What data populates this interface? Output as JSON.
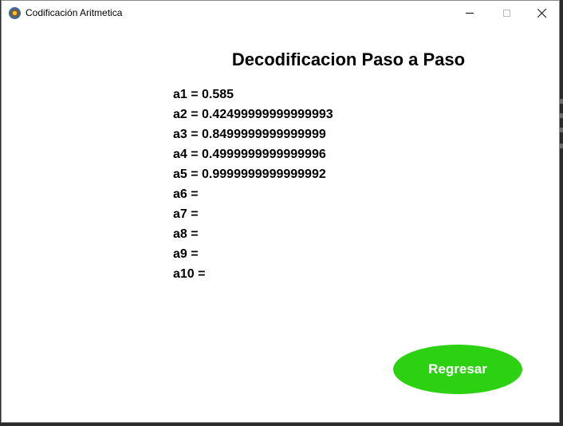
{
  "window": {
    "title": "Codificación Aritmetica",
    "icon": "app-icon"
  },
  "main": {
    "heading": "Decodificacion Paso a Paso",
    "rows": [
      {
        "label": "a1 = ",
        "value": "0.585"
      },
      {
        "label": "a2 = ",
        "value": "0.42499999999999993"
      },
      {
        "label": "a3 = ",
        "value": "0.8499999999999999"
      },
      {
        "label": "a4 = ",
        "value": "0.4999999999999996"
      },
      {
        "label": "a5 = ",
        "value": "0.9999999999999992"
      },
      {
        "label": "a6 = ",
        "value": ""
      },
      {
        "label": "a7 = ",
        "value": ""
      },
      {
        "label": "a8 = ",
        "value": ""
      },
      {
        "label": "a9 = ",
        "value": ""
      },
      {
        "label": "a10 = ",
        "value": ""
      }
    ],
    "back_button_label": "Regresar"
  },
  "colors": {
    "button_bg": "#2cd211",
    "button_text": "#ffffff"
  }
}
